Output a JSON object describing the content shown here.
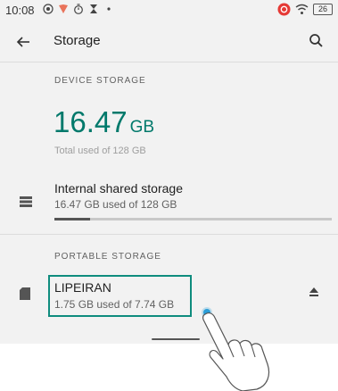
{
  "status_bar": {
    "time": "10:08",
    "battery": "26"
  },
  "app_bar": {
    "title": "Storage",
    "back_icon": "arrow-back-icon",
    "search_icon": "search-icon"
  },
  "device_storage": {
    "section_label": "DEVICE STORAGE",
    "used_value": "16.47",
    "used_unit": "GB",
    "used_caption": "Total used of 128 GB"
  },
  "internal_storage": {
    "icon": "storage-icon",
    "title": "Internal shared storage",
    "subtitle": "16.47 GB used of 128 GB",
    "used_fraction": 0.1287
  },
  "portable_storage": {
    "section_label": "PORTABLE STORAGE",
    "icon": "sd-card-icon",
    "title": "LIPEIRAN",
    "subtitle": "1.75 GB used of 7.74 GB",
    "eject_icon": "eject-icon"
  },
  "colors": {
    "accent": "#00796b",
    "highlight": "#0f8c7e",
    "tap": "#2b9ed8"
  }
}
